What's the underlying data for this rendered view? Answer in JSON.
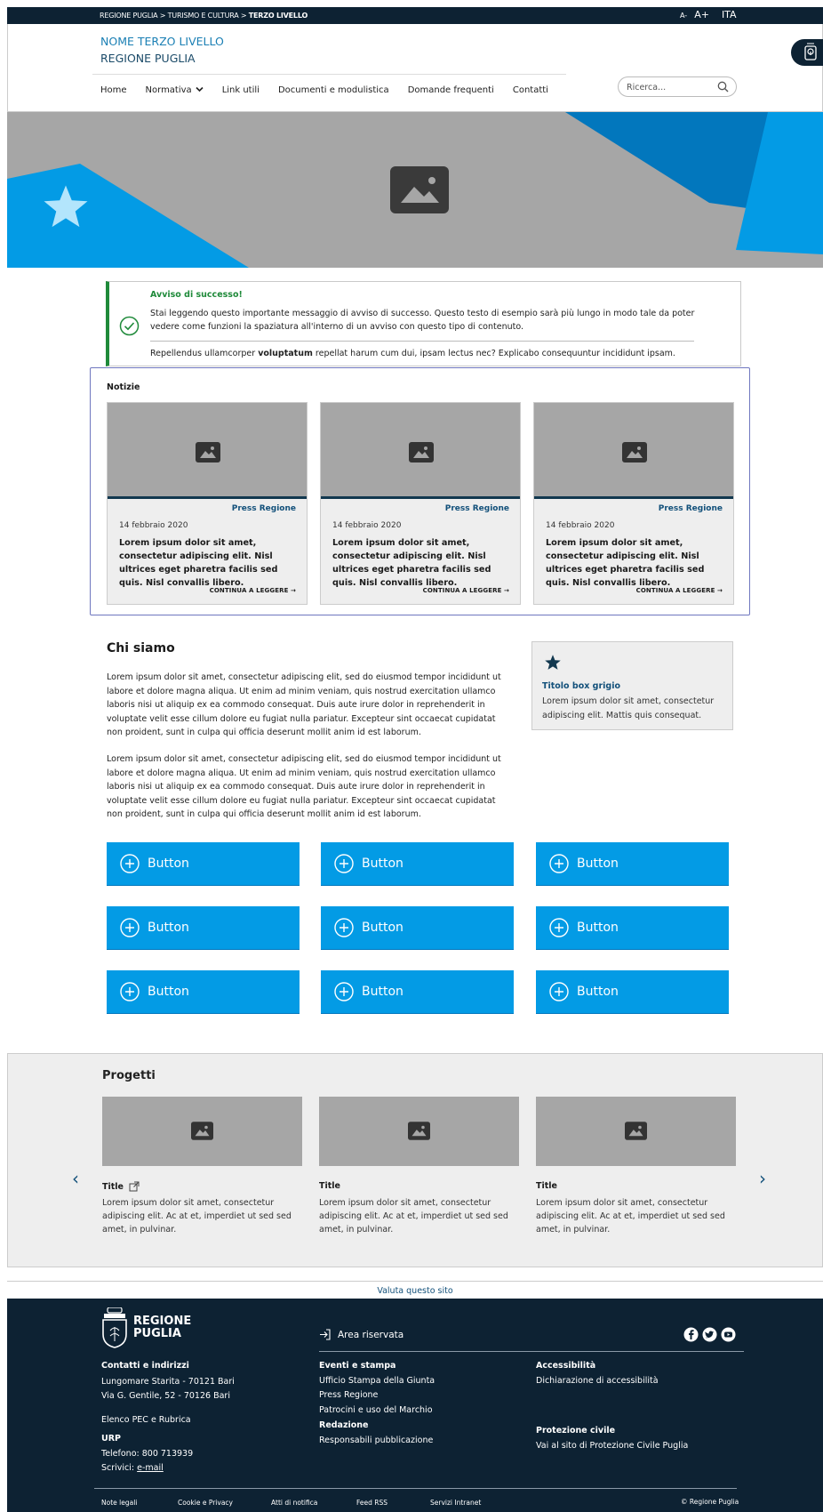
{
  "topbar": {
    "breadcrumb": "REGIONE PUGLIA > TURISMO E CULTURA > ",
    "breadcrumb_current": "TERZO LIVELLO",
    "font_small": "A-",
    "font_large": "A+",
    "language": "ITA"
  },
  "header": {
    "title_line1": "NOME TERZO LIVELLO",
    "title_line2": "REGIONE PUGLIA",
    "search_placeholder": "Ricerca..."
  },
  "nav": [
    {
      "label": "Home"
    },
    {
      "label": "Normativa"
    },
    {
      "label": "Link utili"
    },
    {
      "label": "Documenti e modulistica"
    },
    {
      "label": "Domande frequenti"
    },
    {
      "label": "Contatti"
    }
  ],
  "alert": {
    "title": "Avviso di successo!",
    "message": "Stai leggendo questo importante messaggio di avviso di successo. Questo testo di esempio sarà più lungo in modo tale da poter vedere come funzioni la spaziatura all'interno di un avviso con questo tipo di contenuto.",
    "message2_pre": "Repellendus ullamcorper ",
    "message2_bold": "voluptatum",
    "message2_post": " repellat harum cum dui, ipsam lectus nec? Explicabo consequuntur incididunt ipsam."
  },
  "news": {
    "title": "Notizie",
    "cards": [
      {
        "category": "Press Regione",
        "date": "14 febbraio 2020",
        "text": "Lorem ipsum dolor sit amet, consectetur adipiscing elit. Nisl ultrices eget pharetra facilis sed quis. Nisl convallis libero.",
        "more": "CONTINUA A LEGGERE"
      },
      {
        "category": "Press Regione",
        "date": "14 febbraio 2020",
        "text": "Lorem ipsum dolor sit amet, consectetur adipiscing elit. Nisl ultrices eget pharetra facilis sed quis. Nisl convallis libero.",
        "more": "CONTINUA A LEGGERE"
      },
      {
        "category": "Press Regione",
        "date": "14 febbraio 2020",
        "text": "Lorem ipsum dolor sit amet, consectetur adipiscing elit. Nisl ultrices eget pharetra facilis sed quis. Nisl convallis libero.",
        "more": "CONTINUA A LEGGERE"
      }
    ]
  },
  "about": {
    "title": "Chi siamo",
    "p1": "Lorem ipsum dolor sit amet, consectetur adipiscing elit, sed do eiusmod tempor incididunt ut labore et dolore magna aliqua. Ut enim ad minim veniam, quis nostrud exercitation ullamco laboris nisi ut aliquip ex ea commodo consequat. Duis aute irure dolor in reprehenderit in voluptate velit esse cillum dolore eu fugiat nulla pariatur. Excepteur sint occaecat cupidatat non proident, sunt in culpa qui officia deserunt mollit anim id est laborum.",
    "p2": "Lorem ipsum dolor sit amet, consectetur adipiscing elit, sed do eiusmod tempor incididunt ut labore et dolore magna aliqua. Ut enim ad minim veniam, quis nostrud exercitation ullamco laboris nisi ut aliquip ex ea commodo consequat. Duis aute irure dolor in reprehenderit in voluptate velit esse cillum dolore eu fugiat nulla pariatur. Excepteur sint occaecat cupidatat non proident, sunt in culpa qui officia deserunt mollit anim id est laborum."
  },
  "graybox": {
    "title": "Titolo box grigio",
    "text": "Lorem ipsum dolor sit amet, consectetur adipiscing elit. Mattis quis consequat."
  },
  "buttons": [
    "Button",
    "Button",
    "Button",
    "Button",
    "Button",
    "Button",
    "Button",
    "Button",
    "Button"
  ],
  "projects": {
    "title": "Progetti",
    "cards": [
      {
        "title": "Title",
        "text": "Lorem ipsum dolor sit amet, consectetur adipiscing elit. Ac at et, imperdiet ut sed sed amet, in pulvinar."
      },
      {
        "title": "Title",
        "text": "Lorem ipsum dolor sit amet, consectetur adipiscing elit. Ac at et, imperdiet ut sed sed amet, in pulvinar."
      },
      {
        "title": "Title",
        "text": "Lorem ipsum dolor sit amet, consectetur adipiscing elit. Ac at et, imperdiet ut sed sed amet, in pulvinar."
      }
    ]
  },
  "rate": "Valuta questo sito",
  "footer": {
    "logo_line1": "REGIONE",
    "logo_line2": "PUGLIA",
    "reserved": "Area riservata",
    "contacts_title": "Contatti e indirizzi",
    "address1": "Lungomare Starita - 70121 Bari",
    "address2": "Via G. Gentile, 52 - 70126 Bari",
    "pec": "Elenco PEC e Rubrica",
    "urp_title": "URP",
    "phone": "Telefono: 800 713939",
    "write_prefix": "Scrivici: ",
    "write_link": "e-mail",
    "events_title": "Eventi e stampa",
    "events1": "Ufficio Stampa della Giunta",
    "events2": "Press Regione",
    "events3": "Patrocini e uso del Marchio",
    "redazione_title": "Redazione",
    "redazione1": "Responsabili pubblicazione",
    "access_title": "Accessibilità",
    "access1": "Dichiarazione di accessibilità",
    "civil_title": "Protezione civile",
    "civil1": "Vai al sito di Protezione Civile Puglia",
    "bottom": [
      "Note legali",
      "Cookie e Privacy",
      "Atti di notifica",
      "Feed RSS",
      "Servizi Intranet"
    ],
    "copyright": "© Regione Puglia"
  },
  "colors": {
    "primary": "#039be5",
    "dark": "#0d2233",
    "success": "#1f8a3a",
    "link": "#12507a"
  }
}
